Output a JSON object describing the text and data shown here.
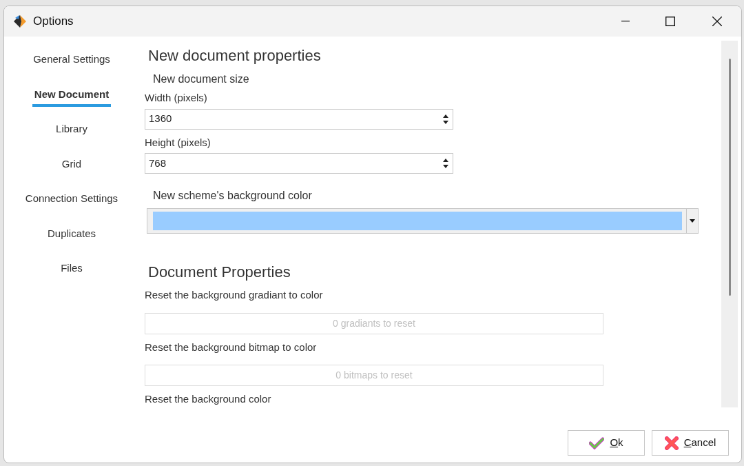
{
  "window": {
    "title": "Options"
  },
  "sidebar": {
    "items": [
      {
        "label": "General Settings",
        "selected": false
      },
      {
        "label": "New Document",
        "selected": true
      },
      {
        "label": "Library",
        "selected": false
      },
      {
        "label": "Grid",
        "selected": false
      },
      {
        "label": "Connection Settings",
        "selected": false
      },
      {
        "label": "Duplicates",
        "selected": false
      },
      {
        "label": "Files",
        "selected": false
      }
    ]
  },
  "new_document": {
    "title": "New document properties",
    "size_heading": "New document size",
    "width": {
      "label": "Width (pixels)",
      "value": "1360"
    },
    "height": {
      "label": "Height (pixels)",
      "value": "768"
    },
    "background": {
      "label": "New scheme's background color",
      "color": "#99ccff"
    }
  },
  "document_properties": {
    "title": "Document Properties",
    "items": [
      {
        "label": "Reset the background gradiant to color",
        "button": "0 gradiants to reset",
        "disabled": true
      },
      {
        "label": "Reset the background bitmap to color",
        "button": "0 bitmaps to reset",
        "disabled": true
      },
      {
        "label": "Reset the background color"
      }
    ]
  },
  "buttons": [
    {
      "kind": "ok",
      "label": "Ok"
    },
    {
      "kind": "cancel",
      "label": "Cancel"
    }
  ]
}
